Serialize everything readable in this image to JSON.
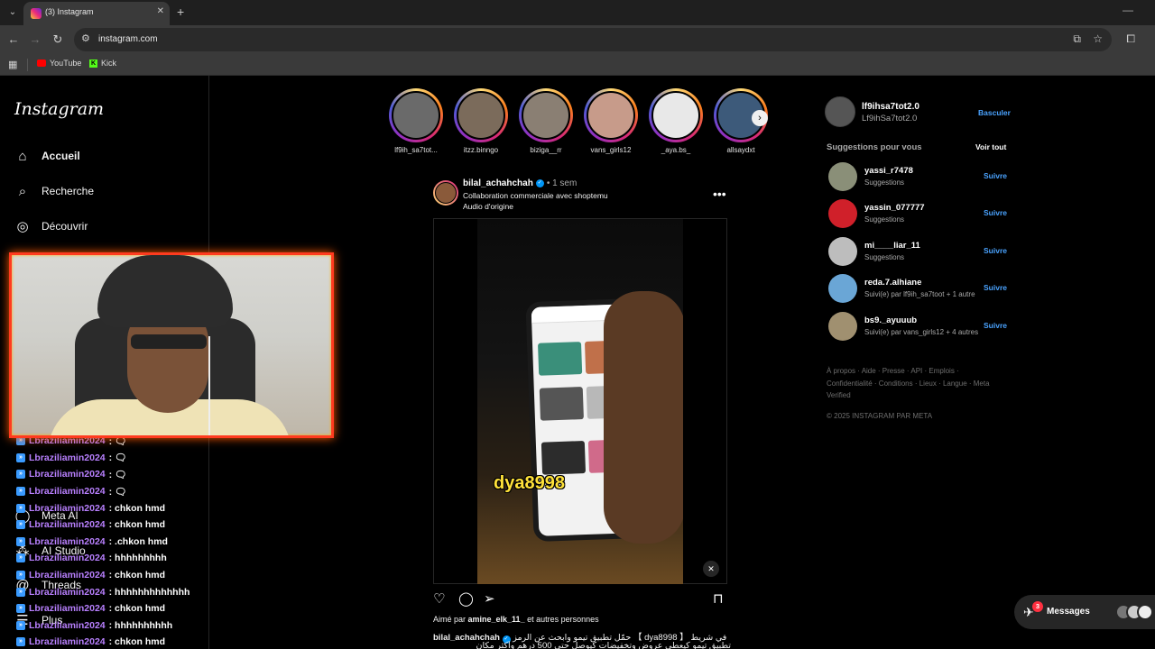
{
  "browser": {
    "tab_title": "(3) Instagram",
    "url": "instagram.com",
    "bookmarks": [
      "YouTube",
      "Kick"
    ]
  },
  "sidebar": {
    "logo": "Instagram",
    "items": [
      {
        "label": "Accueil",
        "icon": "home-icon"
      },
      {
        "label": "Recherche",
        "icon": "search-icon"
      },
      {
        "label": "Découvrir",
        "icon": "compass-icon"
      }
    ],
    "lower_items": [
      {
        "label": "Meta AI",
        "icon": "meta-ai-icon"
      },
      {
        "label": "AI Studio",
        "icon": "ai-studio-icon"
      },
      {
        "label": "Threads",
        "icon": "threads-icon"
      },
      {
        "label": "Plus",
        "icon": "menu-icon"
      }
    ]
  },
  "chat": [
    {
      "user": "Lbraziliamin2024",
      "msg": ": 🗨"
    },
    {
      "user": "Lbraziliamin2024",
      "msg": ": 🗨"
    },
    {
      "user": "Lbraziliamin2024",
      "msg": ": 🗨"
    },
    {
      "user": "Lbraziliamin2024",
      "msg": ": 🗨"
    },
    {
      "user": "Lbraziliamin2024",
      "msg": ": chkon hmd"
    },
    {
      "user": "Lbraziliamin2024",
      "msg": ": chkon hmd"
    },
    {
      "user": "Lbraziliamin2024",
      "msg": ": .chkon hmd"
    },
    {
      "user": "Lbraziliamin2024",
      "msg": ": hhhhhhhhh"
    },
    {
      "user": "Lbraziliamin2024",
      "msg": ": chkon hmd"
    },
    {
      "user": "Lbraziliamin2024",
      "msg": ": hhhhhhhhhhhhh"
    },
    {
      "user": "Lbraziliamin2024",
      "msg": ": chkon hmd"
    },
    {
      "user": "Lbraziliamin2024",
      "msg": ": hhhhhhhhhh"
    },
    {
      "user": "Lbraziliamin2024",
      "msg": ": chkon hmd"
    }
  ],
  "stories": [
    {
      "name": "lf9ih_sa7tot..."
    },
    {
      "name": "itzz.binngo"
    },
    {
      "name": "biziga__rr"
    },
    {
      "name": "vans_girls12"
    },
    {
      "name": "_aya.bs_"
    },
    {
      "name": "allsaydxt"
    }
  ],
  "post": {
    "user": "bilal_achahchah",
    "time": "• 1 sem",
    "line1": "Collaboration commerciale avec shoptemu",
    "line2": "Audio d'origine",
    "overlay_text": "dya8998",
    "liked_prefix": "Aimé par ",
    "liked_user": "amine_elk_11_",
    "liked_suffix": " et autres personnes",
    "caption_user": "bilal_achahchah",
    "caption_text": "حمّل تطبيق تيمو وابحث عن الرمز 【 dya8998 】 في شريط",
    "caption_text2": "تطبيق تيمو كيعطي عروض وتخفيضات كيوصل حتى 500 درهم وأكثر مكان"
  },
  "right": {
    "me_user": "lf9ihsa7tot2.0",
    "me_name": "Lf9ihSa7tot2.0",
    "switch_label": "Basculer",
    "suggestions_title": "Suggestions pour vous",
    "see_all": "Voir tout",
    "follow_label": "Suivre",
    "suggestions": [
      {
        "user": "yassi_r7478",
        "sub": "Suggestions"
      },
      {
        "user": "yassin_077777",
        "sub": "Suggestions"
      },
      {
        "user": "mi____liar_11",
        "sub": "Suggestions"
      },
      {
        "user": "reda.7.alhiane",
        "sub": "Suivi(e) par lf9ih_sa7toot + 1 autre"
      },
      {
        "user": "bs9._ayuuub",
        "sub": "Suivi(e) par vans_girls12 + 4 autres"
      }
    ],
    "footer_links": "À propos · Aide · Presse · API · Emplois · Confidentialité · Conditions · Lieux · Langue · Meta Verified",
    "copyright": "© 2025 INSTAGRAM PAR META"
  },
  "messages": {
    "label": "Messages",
    "badge": "3"
  },
  "colors": {
    "accent_blue": "#0095f6",
    "link_blue": "#4aa3ff",
    "chat_user": "#b980ff",
    "webcam_border": "#ff3b1f"
  }
}
